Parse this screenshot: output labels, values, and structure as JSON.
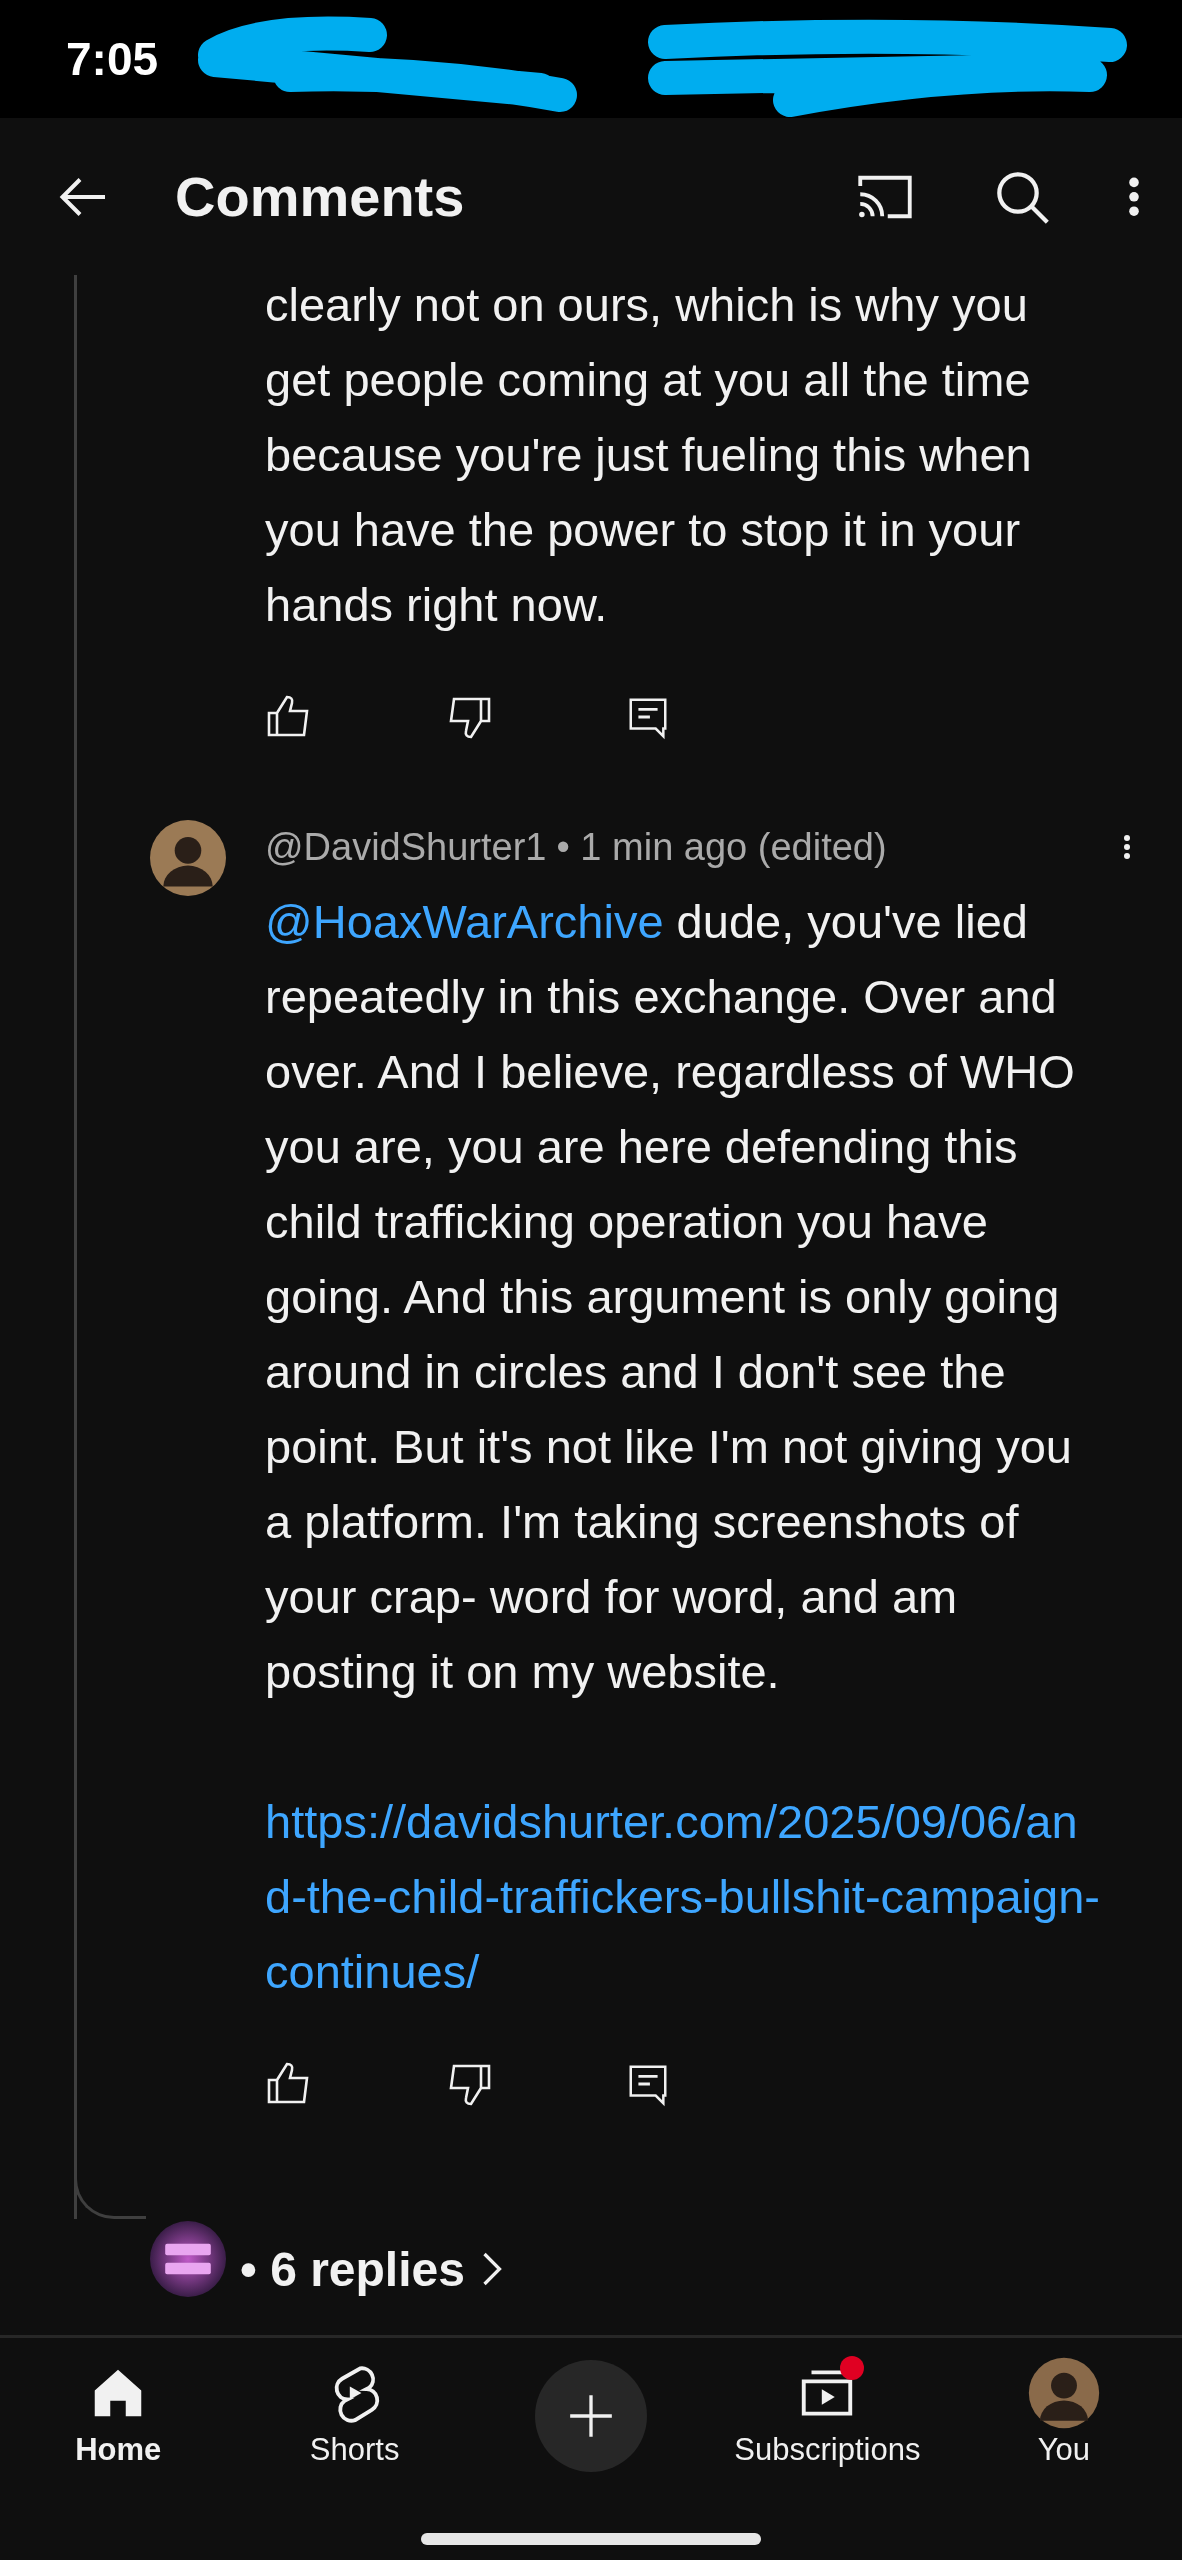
{
  "status_bar": {
    "time": "7:05"
  },
  "app_bar": {
    "title": "Comments"
  },
  "comments": [
    {
      "kind": "continuation",
      "text": "clearly not on ours, which is why you get people coming at you all the time because you're just fueling this when you have the power to stop it in your hands right now."
    },
    {
      "kind": "reply",
      "author": "@DavidShurter1",
      "meta": "• 1 min ago (edited)",
      "mention": "@HoaxWarArchive",
      "text": "dude, you've lied repeatedly in this exchange. Over and over. And I believe, regardless of WHO you are, you are here defending this child trafficking operation you have going. And this argument is only going around in circles and I don't see the point. But it's not like I'm not giving you a platform. I'm taking screenshots of your crap- word for word, and am posting it on my website.",
      "link": "https://davidshurter.com/2025/09/06/and-the-child-traffickers-bullshit-campaign-continues/"
    }
  ],
  "replies": {
    "label": "• 6 replies"
  },
  "bottom_nav": [
    {
      "kind": "home",
      "label": "Home",
      "selected": true
    },
    {
      "kind": "shorts",
      "label": "Shorts",
      "selected": false
    },
    {
      "kind": "create"
    },
    {
      "kind": "subscriptions",
      "label": "Subscriptions",
      "selected": false,
      "notification": true
    },
    {
      "kind": "you",
      "label": "You",
      "selected": false
    }
  ]
}
